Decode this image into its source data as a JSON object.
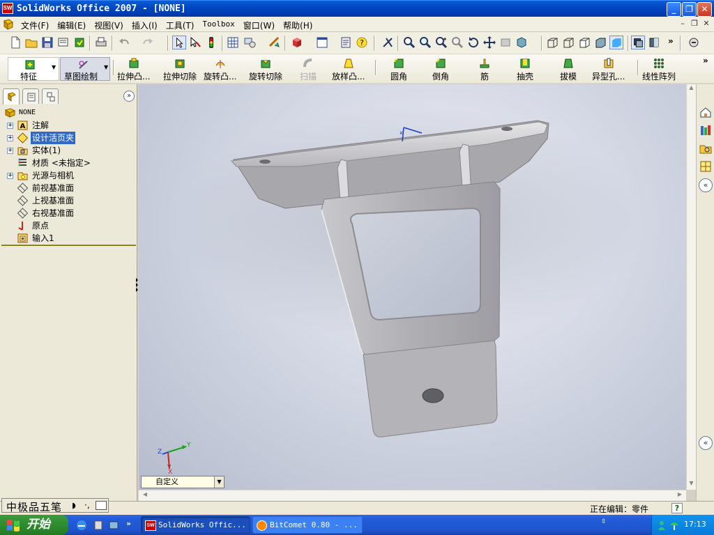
{
  "app": {
    "title": "SolidWorks Office 2007 - [NONE]",
    "icon_label": "SW"
  },
  "menubar": {
    "items": [
      "文件(F)",
      "编辑(E)",
      "视图(V)",
      "插入(I)",
      "工具(T)",
      "Toolbox",
      "窗口(W)",
      "帮助(H)"
    ]
  },
  "commandmanager": {
    "features_label": "特征",
    "sketch_label": "草图绘制",
    "commands": [
      "拉伸凸...",
      "拉伸切除",
      "旋转凸...",
      "旋转切除",
      "扫描",
      "放样凸...",
      "圆角",
      "倒角",
      "筋",
      "抽壳",
      "拔模",
      "异型孔...",
      "线性阵列"
    ]
  },
  "feature_tree": {
    "root": "NONE",
    "nodes": [
      {
        "label": "注解",
        "icon": "annotations-icon",
        "expandable": true
      },
      {
        "label": "设计活页夹",
        "icon": "design-binder-icon",
        "expandable": true,
        "selected": true
      },
      {
        "label": "实体(1)",
        "icon": "solid-bodies-icon",
        "expandable": true
      },
      {
        "label": "材质 <未指定>",
        "icon": "material-icon",
        "expandable": false
      },
      {
        "label": "光源与相机",
        "icon": "lights-cameras-icon",
        "expandable": true
      },
      {
        "label": "前视基准面",
        "icon": "plane-icon",
        "expandable": false
      },
      {
        "label": "上视基准面",
        "icon": "plane-icon",
        "expandable": false
      },
      {
        "label": "右视基准面",
        "icon": "plane-icon",
        "expandable": false
      },
      {
        "label": "原点",
        "icon": "origin-icon",
        "expandable": false
      },
      {
        "label": "输入1",
        "icon": "imported-feature-icon",
        "expandable": false
      }
    ]
  },
  "graphics": {
    "view_orientation": "自定义",
    "triad_labels": {
      "x": "X",
      "y": "Y",
      "z": "Z"
    }
  },
  "statusbar": {
    "status": "正在编辑：零件",
    "help": "?"
  },
  "ime": {
    "text": "中极品五笔"
  },
  "taskbar": {
    "start_label": "开始",
    "items": [
      {
        "label": "SolidWorks Offic...",
        "active": true
      },
      {
        "label": "BitComet 0.80 - ...",
        "active": false
      }
    ],
    "clock": "17:13"
  },
  "colors": {
    "titlebar": "#0045c0",
    "selection": "#316ac5",
    "taskbar": "#245edb",
    "start": "#2e8c2e"
  }
}
